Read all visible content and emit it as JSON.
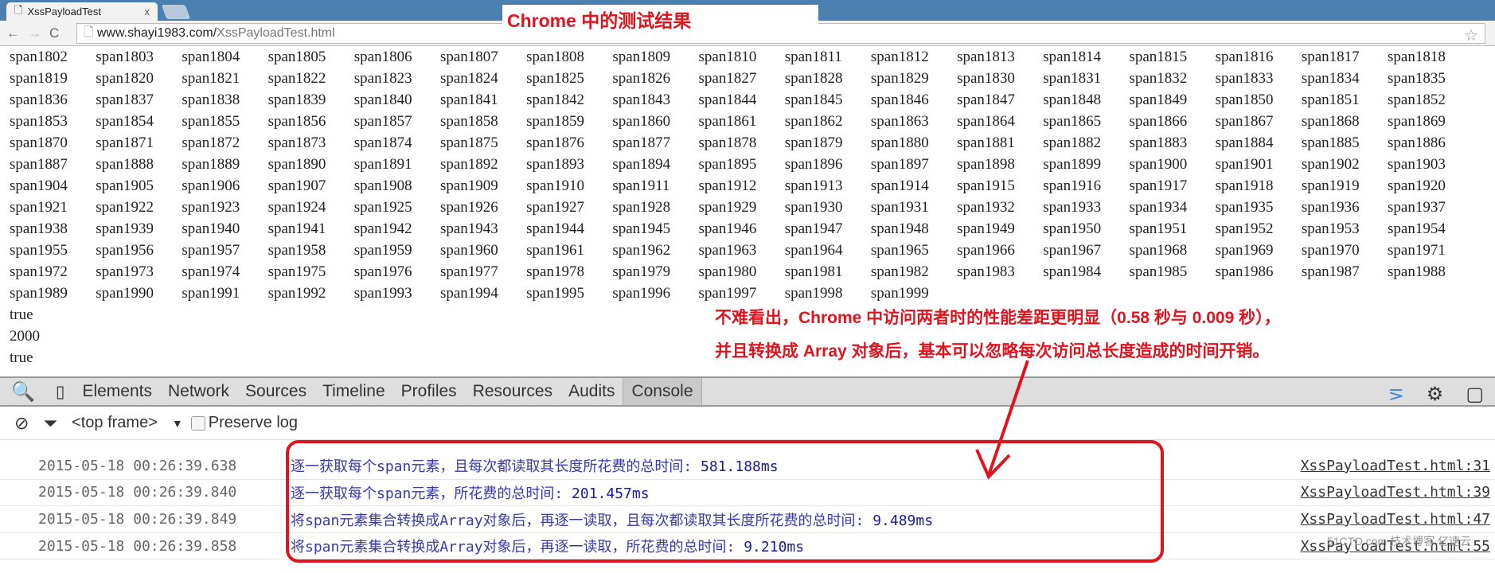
{
  "browser": {
    "tab_title": "XssPayloadTest",
    "tab_close": "x",
    "url_host": "www.shayi1983.com/",
    "url_path": "XssPayloadTest.html"
  },
  "overlay": {
    "title": "Chrome 中的测试结果",
    "note_line1": "不难看出，Chrome 中访问两者时的性能差距更明显（0.58 秒与 0.009 秒），",
    "note_line2": "并且转换成 Array 对象后，基本可以忽略每次访问总长度造成的时间开销。",
    "accent": "#e0141e"
  },
  "page": {
    "span_prefix": "span",
    "span_first": 1802,
    "span_last": 1999,
    "lines": [
      "true",
      "2000",
      "true"
    ]
  },
  "devtools": {
    "tabs": [
      "Elements",
      "Network",
      "Sources",
      "Timeline",
      "Profiles",
      "Resources",
      "Audits",
      "Console"
    ],
    "active_tab": "Console",
    "frame_select": "<top frame>",
    "preserve_log": "Preserve log",
    "logs": [
      {
        "time": "2015-05-18 00:26:39.638",
        "text": "逐一获取每个span元素，且每次都读取其长度所花费的总时间: ",
        "value": "581.188ms",
        "source": "XssPayloadTest.html:31"
      },
      {
        "time": "2015-05-18 00:26:39.840",
        "text": "逐一获取每个span元素，所花费的总时间: ",
        "value": "201.457ms",
        "source": "XssPayloadTest.html:39"
      },
      {
        "time": "2015-05-18 00:26:39.849",
        "text": "将span元素集合转换成Array对象后，再逐一读取，且每次都读取其长度所花费的总时间: ",
        "value": "9.489ms",
        "source": "XssPayloadTest.html:47"
      },
      {
        "time": "2015-05-18 00:26:39.858",
        "text": "将span元素集合转换成Array对象后，再逐一读取，所花费的总时间: ",
        "value": "9.210ms",
        "source": "XssPayloadTest.html:55"
      }
    ]
  },
  "watermark": "51CTO.com 技术博客 亿速云"
}
